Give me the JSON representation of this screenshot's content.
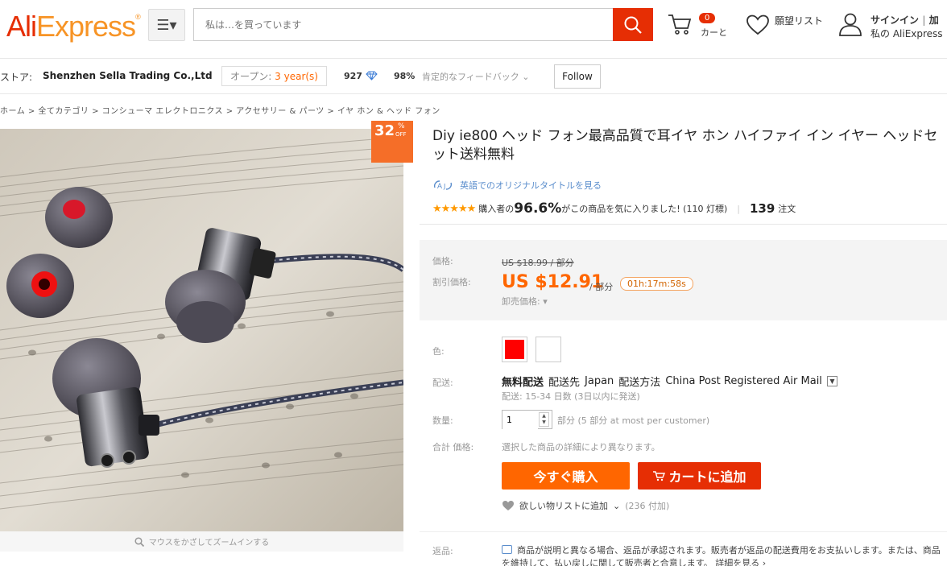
{
  "header": {
    "logo_ali": "Ali",
    "logo_express": "Express",
    "search_placeholder": "私は…を買っています",
    "cart_count": "0",
    "cart_label": "カーと",
    "wishlist_label": "願望リスト",
    "account_line1": "サインイン",
    "account_sep": "|",
    "account_partial": "加",
    "account_line2": "私の AliExpress"
  },
  "store": {
    "label": "ストア:",
    "name": "Shenzhen Sella Trading Co.,Ltd",
    "open_label": "オープン:",
    "open_years": "3 year(s)",
    "score": "927",
    "feedback_pct": "98%",
    "feedback_label": "肯定的なフィードバック",
    "follow": "Follow"
  },
  "breadcrumb": "ホーム > 全てカテゴリ > コンシューマ エレクトロニクス > アクセサリー & パーツ > イヤ ホン & ヘッド フォン",
  "gallery": {
    "discount_pct": "32",
    "discount_pct_sign": "%",
    "discount_off": "OFF",
    "zoom_hint": "マウスをかざしてズームインする"
  },
  "product": {
    "title": "Diy ie800 ヘッド フォン最高品質で耳イヤ ホン ハイファイ イン イヤー ヘッドセット送料無料",
    "translate_link": "英語でのオリジナルタイトルを見る",
    "stars": "★★★★★",
    "rating_prefix": "購入者の",
    "rating_pct": "96.6%",
    "rating_suffix": "がこの商品を気に入りました! (110 灯標)",
    "orders_count": "139",
    "orders_label": "注文"
  },
  "price": {
    "label": "価格:",
    "original": "US $18.99 / 部分",
    "discount_label": "割引価格:",
    "sale": "US $12.91",
    "unit": "/ 部分",
    "timer": "01h:17m:58s",
    "wholesale": "卸売価格:"
  },
  "options": {
    "color_label": "色:",
    "shipping_label": "配送:",
    "shipping_free": "無料配送",
    "shipping_dest_label": "配送先",
    "shipping_dest": "Japan",
    "shipping_method_label": "配送方法",
    "shipping_method": "China Post Registered Air Mail",
    "shipping_time": "配送: 15-34 日数 (3日以内に発送)",
    "qty_label": "数量:",
    "qty_value": "1",
    "qty_note": "部分 (5 部分 at most per customer)",
    "total_label": "合計 価格:",
    "total_note": "選択した商品の詳細により異なります。"
  },
  "actions": {
    "buy_now": "今すぐ購入",
    "add_cart": "カートに追加",
    "wishlist": "欲しい物リストに追加",
    "wishlist_count": "(236 付加)"
  },
  "returns": {
    "label": "返品:",
    "text": "商品が説明と異なる場合、返品が承認されます。販売者が返品の配送費用をお支払いします。または、商品を維持して、払い戻しに関して販売者と合意します。",
    "more": "詳細を見る ›"
  },
  "colors": {
    "brand_red": "#e62e04",
    "brand_orange": "#f60",
    "swatch_red": "#ff0000",
    "swatch_white": "#ffffff"
  }
}
